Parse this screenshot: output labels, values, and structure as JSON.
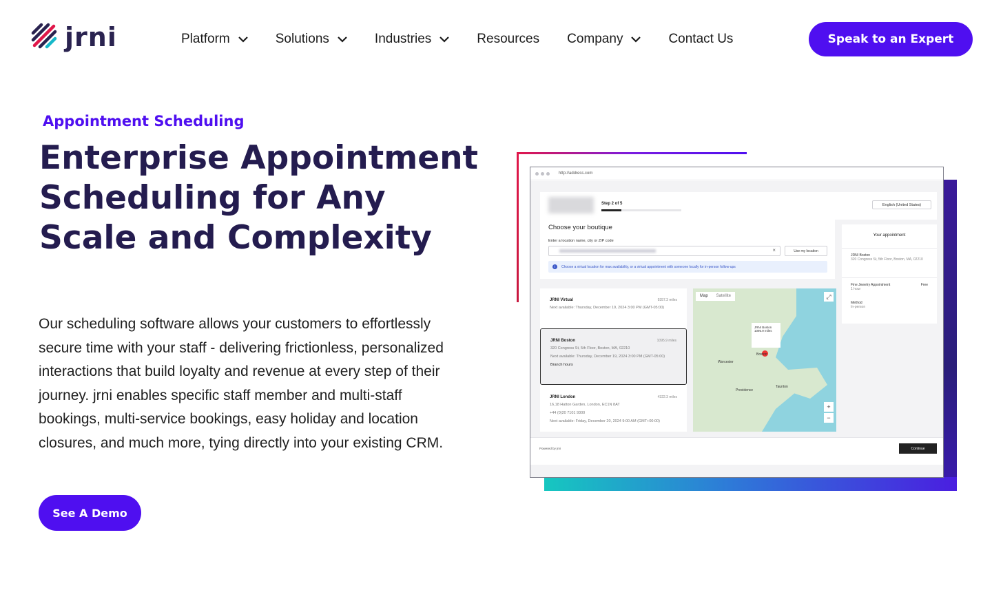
{
  "brand": {
    "name": "jrni",
    "accent": "#4f0ff0",
    "headline_color": "#241c4f"
  },
  "nav": {
    "items": [
      {
        "label": "Platform",
        "has_dropdown": true
      },
      {
        "label": "Solutions",
        "has_dropdown": true
      },
      {
        "label": "Industries",
        "has_dropdown": true
      },
      {
        "label": "Resources",
        "has_dropdown": false
      },
      {
        "label": "Company",
        "has_dropdown": true
      },
      {
        "label": "Contact Us",
        "has_dropdown": false
      }
    ],
    "cta_label": "Speak to an Expert"
  },
  "hero": {
    "eyebrow": "Appointment Scheduling",
    "headline": "Enterprise Appointment Scheduling for Any Scale and Complexity",
    "body": "Our scheduling software allows your customers to effortlessly secure time with your staff - delivering frictionless, personalized interactions that build loyalty and revenue at every step of their journey. jrni enables specific staff member and multi-staff bookings, multi-service bookings, easy holiday and location closures, and much more, tying directly into your existing CRM.",
    "demo_label": "See A Demo"
  },
  "mockup": {
    "url": "http://address.com",
    "step": "Step 2 of 5",
    "step_progress": 0.25,
    "language": "English (United States)",
    "choose_title": "Choose your boutique",
    "search_label": "Enter a location name, city or ZIP code",
    "use_location": "Use my location",
    "info_text": "Choose a virtual location for max availability, or a virtual appointment with someone locally for in-person follow-ups",
    "locations": [
      {
        "name": "JRNI Virtual",
        "distance": "9357.3 miles",
        "next": "Next available: Thursday, December 19, 2024 3:00 PM (GMT-05:00)"
      },
      {
        "name": "JRNI Boston",
        "distance": "1095.9 miles",
        "address": "320 Congress St, 5th Floor, Boston, MA, 02210",
        "next": "Next available: Thursday, December 19, 2024 3:00 PM (GMT-05:00)",
        "extra": "Branch hours"
      },
      {
        "name": "JRNI London",
        "distance": "4322.3 miles",
        "address": "16,18 Hatton Garden, London, EC1N 8AT",
        "phone": "+44 (0)20 7101 9300",
        "next": "Next available: Friday, December 20, 2024 9:00 AM (GMT+00:00)"
      }
    ],
    "map": {
      "tab_map": "Map",
      "tab_satellite": "Satellite",
      "popup_name": "JRNI Boston",
      "popup_dist": "1095.9 miles",
      "cities": [
        "Worcester",
        "Boston",
        "Providence",
        "Taunton"
      ]
    },
    "appointment": {
      "title": "Your appointment",
      "location": "JRNI Boston",
      "address": "320 Congress St, 5th Floor, Boston, MA, 02210",
      "service": "Fine Jewelry Appointment",
      "price": "Free",
      "duration": "1 hour",
      "method_label": "Method",
      "method": "In-person"
    },
    "powered": "Powered by jrni",
    "continue_label": "Continue"
  }
}
